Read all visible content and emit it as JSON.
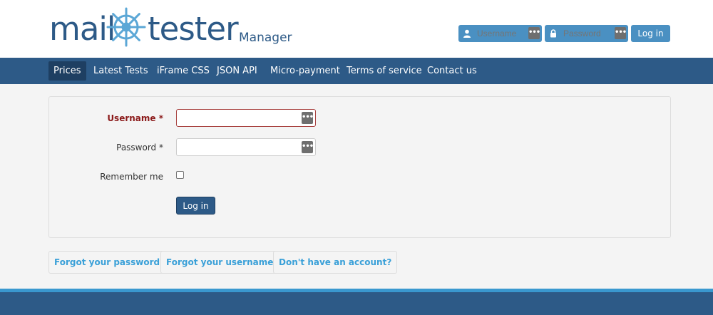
{
  "brand": {
    "logo_left": "mail",
    "logo_right": "tester",
    "subtitle": "Manager"
  },
  "header_login": {
    "username_placeholder": "Username",
    "password_placeholder": "Password",
    "login_label": "Log in",
    "user_icon": "user-icon",
    "lock_icon": "lock-icon"
  },
  "nav": {
    "items": [
      {
        "label": "Prices",
        "active": true
      },
      {
        "label": "Latest Tests",
        "active": false
      },
      {
        "label": "iFrame CSS",
        "active": false
      },
      {
        "label": "JSON API",
        "active": false
      },
      {
        "label": "Micro-payment",
        "active": false
      },
      {
        "label": "Terms of service",
        "active": false
      },
      {
        "label": "Contact us",
        "active": false
      }
    ]
  },
  "form": {
    "username_label": "Username *",
    "username_value": "",
    "password_label": "Password *",
    "password_value": "",
    "remember_label": "Remember me",
    "remember_checked": false,
    "submit_label": "Log in"
  },
  "links": {
    "forgot_password": "Forgot your password?",
    "forgot_username": "Forgot your username?",
    "no_account": "Don't have an account?"
  },
  "colors": {
    "brand_blue": "#2d5a87",
    "accent_blue": "#4a90c2",
    "link_blue": "#3aa0d8",
    "error_red": "#8b1a1a"
  }
}
